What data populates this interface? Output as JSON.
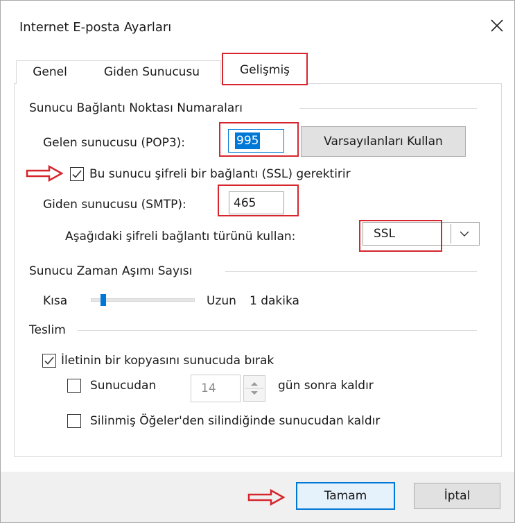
{
  "window": {
    "title": "Internet E-posta Ayarları"
  },
  "tabs": [
    {
      "label": "Genel"
    },
    {
      "label": "Giden Sunucusu"
    },
    {
      "label": "Gelişmiş"
    }
  ],
  "server_ports": {
    "group_label": "Sunucu Bağlantı Noktası Numaraları",
    "incoming_label": "Gelen sunucusu (POP3):",
    "incoming_value": "995",
    "defaults_button": "Varsayılanları Kullan",
    "ssl_checkbox_label": "Bu sunucu şifreli bir bağlantı (SSL) gerektirir",
    "ssl_checked": true,
    "outgoing_label": "Giden sunucusu (SMTP):",
    "outgoing_value": "465",
    "encryption_label": "Aşağıdaki şifreli bağlantı türünü kullan:",
    "encryption_value": "SSL"
  },
  "timeout": {
    "group_label": "Sunucu Zaman Aşımı Sayısı",
    "short_label": "Kısa",
    "long_label": "Uzun",
    "value_text": "1 dakika",
    "level_fraction": 0.1
  },
  "delivery": {
    "group_label": "Teslim",
    "leave_copy_label": "İletinin bir kopyasını sunucuda bırak",
    "leave_copy_checked": true,
    "remove_after_label_pre": "Sunucudan",
    "remove_after_days": "14",
    "remove_after_label_post": "gün sonra kaldır",
    "remove_after_checked": false,
    "remove_deleted_label": "Silinmiş Öğeler'den silindiğinde sunucudan kaldır",
    "remove_deleted_checked": false
  },
  "footer": {
    "ok_label": "Tamam",
    "cancel_label": "İptal"
  },
  "colors": {
    "annotation_red": "#d6252c",
    "selection_blue": "#0078d7",
    "button_default_border": "#0078d7"
  }
}
